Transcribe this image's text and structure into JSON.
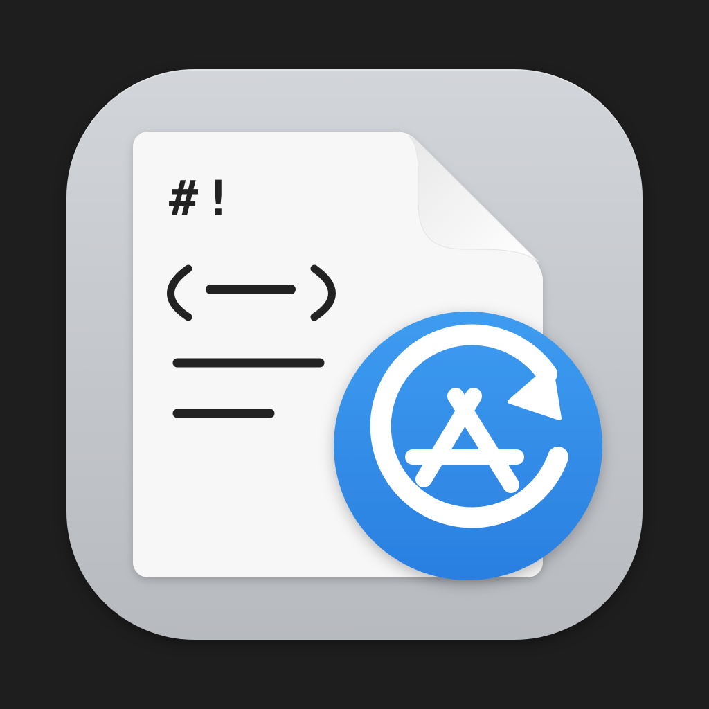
{
  "icon": {
    "document": {
      "shebang_text": "#!"
    },
    "badge": {
      "icon_name": "app-store-update-icon",
      "color": "#2f86e6"
    },
    "colors": {
      "background": "#1e1e1e",
      "tile": "#c8cbcf",
      "document": "#f7f7f7",
      "glyph": "#222222",
      "badge": "#2f86e6"
    }
  }
}
